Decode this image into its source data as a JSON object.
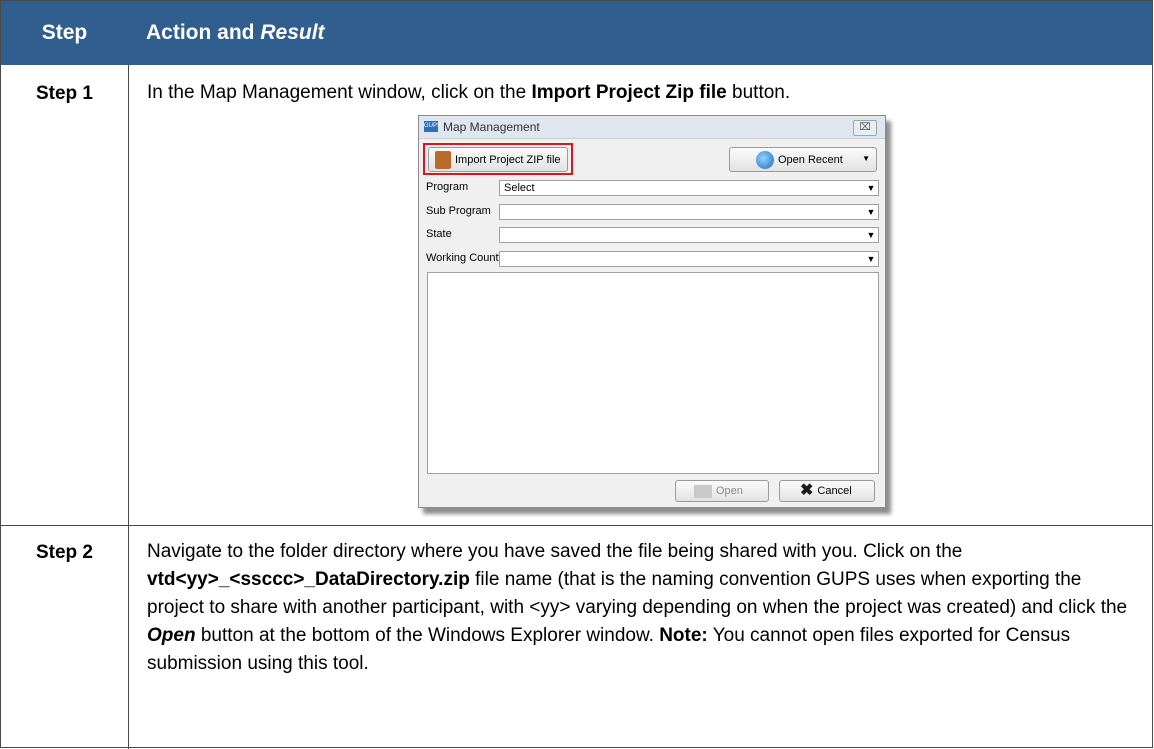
{
  "header": {
    "col_step": "Step",
    "col_action_prefix": "Action and ",
    "col_action_italic": "Result"
  },
  "steps": [
    {
      "label": "Step 1",
      "text_1": "In the Map Management window, click on the ",
      "bold_1": "Import Project Zip file",
      "text_2": " button."
    },
    {
      "label": "Step 2",
      "text_1": "Navigate to the folder directory where you have saved the file being shared with you. Click on the ",
      "bold_1": "vtd<yy>_<ssccc>_DataDirectory.zip",
      "text_2": " file name (that is the naming convention GUPS uses when exporting the project to share with another participant, with <yy> varying depending on when the project was created) and click the ",
      "bold_italic_1": "Open",
      "text_3": " button at the bottom of the Windows Explorer window. ",
      "bold_2": "Note:",
      "text_4": " You cannot open files exported for Census submission using this tool."
    }
  ],
  "dialog": {
    "app_icon": "GUPS",
    "title": "Map Management",
    "close_glyph": "⌧",
    "import_label": "Import Project ZIP file",
    "open_recent_label": "Open Recent",
    "fields": [
      {
        "label": "Program",
        "value": "Select"
      },
      {
        "label": "Sub Program",
        "value": ""
      },
      {
        "label": "State",
        "value": ""
      },
      {
        "label": "Working County",
        "value": ""
      }
    ],
    "open_label": "Open",
    "cancel_label": "Cancel"
  },
  "colors": {
    "header_bg": "#305f8f",
    "highlight": "#e0141e"
  }
}
